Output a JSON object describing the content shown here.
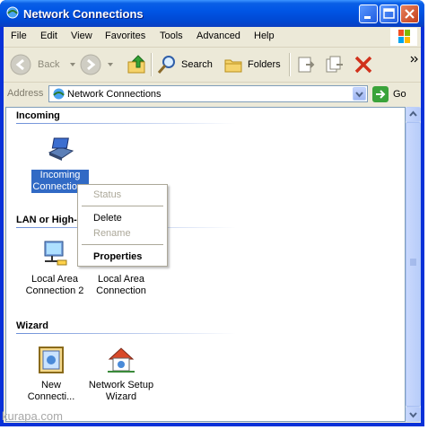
{
  "window": {
    "title": "Network Connections"
  },
  "menu": [
    "File",
    "Edit",
    "View",
    "Favorites",
    "Tools",
    "Advanced",
    "Help"
  ],
  "toolbar": {
    "back": "Back",
    "search": "Search",
    "folders": "Folders"
  },
  "address": {
    "label": "Address",
    "value": "Network Connections",
    "go": "Go"
  },
  "groups": [
    {
      "title": "Incoming",
      "items": [
        {
          "line1": "Incoming",
          "line2": "Connections"
        }
      ]
    },
    {
      "title": "LAN or High-",
      "items": [
        {
          "line1": "Local Area",
          "line2": "Connection 2"
        },
        {
          "line1": "Local Area",
          "line2": "Connection"
        }
      ]
    },
    {
      "title": "Wizard",
      "items": [
        {
          "line1": "New",
          "line2": "Connecti..."
        },
        {
          "line1": "Network Setup",
          "line2": "Wizard"
        }
      ]
    }
  ],
  "context_menu": [
    {
      "label": "Status",
      "state": "disabled"
    },
    {
      "label": "Delete",
      "state": "enabled"
    },
    {
      "label": "Rename",
      "state": "disabled"
    },
    {
      "label": "Properties",
      "state": "default"
    }
  ],
  "watermark": "kurapa.com",
  "colors": {
    "title_blue": "#0055e5",
    "selection": "#316ac5",
    "face": "#ece9d8"
  }
}
